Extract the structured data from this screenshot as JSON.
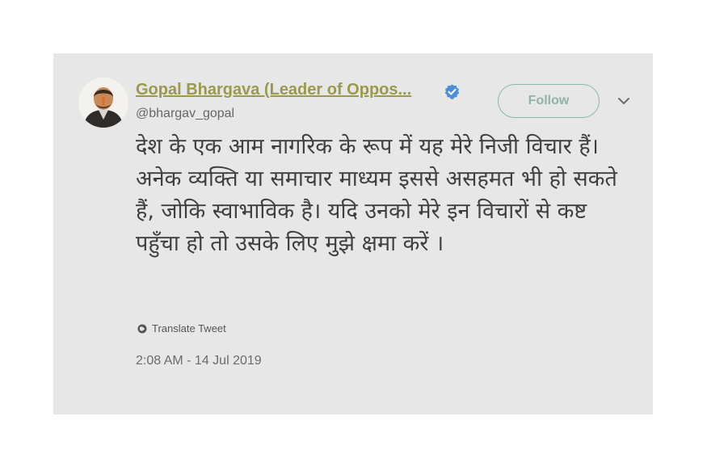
{
  "tweet": {
    "display_name": "Gopal Bhargava (Leader of Oppos...",
    "handle": "@bhargav_gopal",
    "follow_label": "Follow",
    "text": "देश के एक आम नागरिक के रूप में यह मेरे निजी विचार हैं। अनेक व्यक्ति या समाचार माध्यम इससे असहमत भी हो सकते हैं, जोकि स्वाभाविक है। यदि उनको मेरे इन विचारों से कष्ट पहुँचा हो तो उसके लिए मुझे क्षमा करें ।",
    "translate_label": "Translate Tweet",
    "timestamp": "2:08 AM - 14 Jul 2019"
  },
  "icons": {
    "verified": "verified-badge-icon",
    "caret": "chevron-down-icon",
    "translate": "globe-icon"
  },
  "colors": {
    "card_background": "#e7e7e7",
    "name_color": "#9a9a4a",
    "verified_color": "#4a90d9",
    "follow_border": "#8cb8ac"
  }
}
